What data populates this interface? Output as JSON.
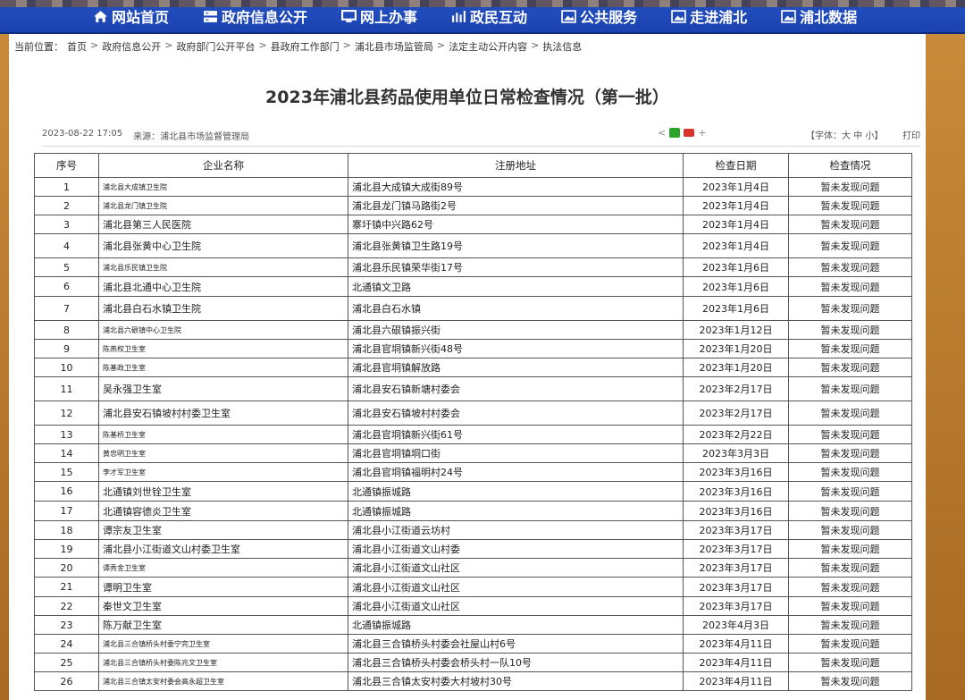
{
  "nav": [
    {
      "icon": "home-icon",
      "label": "网站首页"
    },
    {
      "icon": "server-icon",
      "label": "政府信息公开"
    },
    {
      "icon": "monitor-icon",
      "label": "网上办事"
    },
    {
      "icon": "bar-chart-icon",
      "label": "政民互动"
    },
    {
      "icon": "image-icon",
      "label": "公共服务"
    },
    {
      "icon": "image-icon",
      "label": "走进浦北"
    },
    {
      "icon": "image-icon",
      "label": "浦北数据"
    }
  ],
  "breadcrumb": {
    "prefix": "当前位置：",
    "items": [
      "首页",
      "政府信息公开",
      "政府部门公开平台",
      "县政府工作部门",
      "浦北县市场监管局",
      "法定主动公开内容",
      "执法信息"
    ]
  },
  "article": {
    "title": "2023年浦北县药品使用单位日常检查情况（第一批）",
    "date": "2023-08-22 17:05",
    "source": "来源：浦北县市场监督管理局",
    "font_size_label": "【字体：大 中 小】",
    "print_label": "打印",
    "share_more": "+"
  },
  "table": {
    "headers": [
      "序号",
      "企业名称",
      "注册地址",
      "检查日期",
      "检查情况"
    ],
    "rows": [
      {
        "no": "1",
        "name": "浦北县大成镇卫生院",
        "addr": "浦北县大成镇大成街89号",
        "date": "2023年1月4日",
        "result": "暂未发现问题",
        "small": true,
        "h": 21
      },
      {
        "no": "2",
        "name": "浦北县龙门镇卫生院",
        "addr": "浦北县龙门镇马路街2号",
        "date": "2023年1月4日",
        "result": "暂未发现问题",
        "small": true,
        "h": 21
      },
      {
        "no": "3",
        "name": "浦北县第三人民医院",
        "addr": "寨圩镇中兴路62号",
        "date": "2023年1月4日",
        "result": "暂未发现问题",
        "small": false,
        "h": 21
      },
      {
        "no": "4",
        "name": "浦北县张黄中心卫生院",
        "addr": "浦北县张黄镇卫生路19号",
        "date": "2023年1月4日",
        "result": "暂未发现问题",
        "small": false,
        "h": 27
      },
      {
        "no": "5",
        "name": "浦北县乐民镇卫生院",
        "addr": "浦北县乐民镇荣华街17号",
        "date": "2023年1月6日",
        "result": "暂未发现问题",
        "small": true,
        "h": 21
      },
      {
        "no": "6",
        "name": "浦北县北通中心卫生院",
        "addr": "北通镇文卫路",
        "date": "2023年1月6日",
        "result": "暂未发现问题",
        "small": false,
        "h": 22
      },
      {
        "no": "7",
        "name": "浦北县白石水镇卫生院",
        "addr": "浦北县白石水镇",
        "date": "2023年1月6日",
        "result": "暂未发现问题",
        "small": false,
        "h": 27
      },
      {
        "no": "8",
        "name": "浦北县六硍镇中心卫生院",
        "addr": "浦北县六硍镇振兴街",
        "date": "2023年1月12日",
        "result": "暂未发现问题",
        "small": true,
        "h": 21
      },
      {
        "no": "9",
        "name": "陈燕权卫生室",
        "addr": "浦北县官垌镇新兴街48号",
        "date": "2023年1月20日",
        "result": "暂未发现问题",
        "small": true,
        "h": 21
      },
      {
        "no": "10",
        "name": "陈基政卫生室",
        "addr": "浦北县官垌镇解放路",
        "date": "2023年1月20日",
        "result": "暂未发现问题",
        "small": true,
        "h": 21
      },
      {
        "no": "11",
        "name": "吴永强卫生室",
        "addr": "浦北县安石镇新塘村委会",
        "date": "2023年2月17日",
        "result": "暂未发现问题",
        "small": false,
        "h": 27
      },
      {
        "no": "12",
        "name": "浦北县安石镇坡村村委卫生室",
        "addr": "浦北县安石镇坡村村委会",
        "date": "2023年2月17日",
        "result": "暂未发现问题",
        "small": false,
        "h": 27
      },
      {
        "no": "13",
        "name": "陈基桥卫生室",
        "addr": "浦北县官垌镇新兴街61号",
        "date": "2023年2月22日",
        "result": "暂未发现问题",
        "small": true,
        "h": 21
      },
      {
        "no": "14",
        "name": "黄忠明卫生室",
        "addr": "浦北县官垌镇垌口街",
        "date": "2023年3月3日",
        "result": "暂未发现问题",
        "small": true,
        "h": 21
      },
      {
        "no": "15",
        "name": "李才军卫生室",
        "addr": "浦北县官垌镇福明村24号",
        "date": "2023年3月16日",
        "result": "暂未发现问题",
        "small": true,
        "h": 21
      },
      {
        "no": "16",
        "name": "北通镇刘世铨卫生室",
        "addr": "北通镇振城路",
        "date": "2023年3月16日",
        "result": "暂未发现问题",
        "small": false,
        "h": 22
      },
      {
        "no": "17",
        "name": "北通镇容德炎卫生室",
        "addr": "北通镇振城路",
        "date": "2023年3月16日",
        "result": "暂未发现问题",
        "small": false,
        "h": 22
      },
      {
        "no": "18",
        "name": "谭宗友卫生室",
        "addr": "浦北县小江街道云坊村",
        "date": "2023年3月17日",
        "result": "暂未发现问题",
        "small": false,
        "h": 21
      },
      {
        "no": "19",
        "name": "浦北县小江街道文山村委卫生室",
        "addr": "浦北县小江街道文山村委",
        "date": "2023年3月17日",
        "result": "暂未发现问题",
        "small": false,
        "h": 21
      },
      {
        "no": "20",
        "name": "谭秀金卫生室",
        "addr": "浦北县小江街道文山社区",
        "date": "2023年3月17日",
        "result": "暂未发现问题",
        "small": true,
        "h": 21
      },
      {
        "no": "21",
        "name": "谭明卫生室",
        "addr": "浦北县小江街道文山社区",
        "date": "2023年3月17日",
        "result": "暂未发现问题",
        "small": false,
        "h": 22
      },
      {
        "no": "22",
        "name": "秦世文卫生室",
        "addr": "浦北县小江街道文山社区",
        "date": "2023年3月17日",
        "result": "暂未发现问题",
        "small": false,
        "h": 21
      },
      {
        "no": "23",
        "name": "陈万献卫生室",
        "addr": "北通镇振城路",
        "date": "2023年4月3日",
        "result": "暂未发现问题",
        "small": false,
        "h": 21
      },
      {
        "no": "24",
        "name": "浦北县三合镇桥头村委宁完卫生室",
        "addr": "浦北县三合镇桥头村委会社屋山村6号",
        "date": "2023年4月11日",
        "result": "暂未发现问题",
        "small": true,
        "h": 21
      },
      {
        "no": "25",
        "name": "浦北县三合镇桥头村委陈兆文卫生室",
        "addr": "浦北县三合镇桥头村委会桥头村一队10号",
        "date": "2023年4月11日",
        "result": "暂未发现问题",
        "small": true,
        "h": 21
      },
      {
        "no": "26",
        "name": "浦北县三合镇太安村委会高永超卫生室",
        "addr": "浦北县三合镇太安村委大村坡村30号",
        "date": "2023年4月11日",
        "result": "暂未发现问题",
        "small": true,
        "h": 21
      }
    ]
  }
}
